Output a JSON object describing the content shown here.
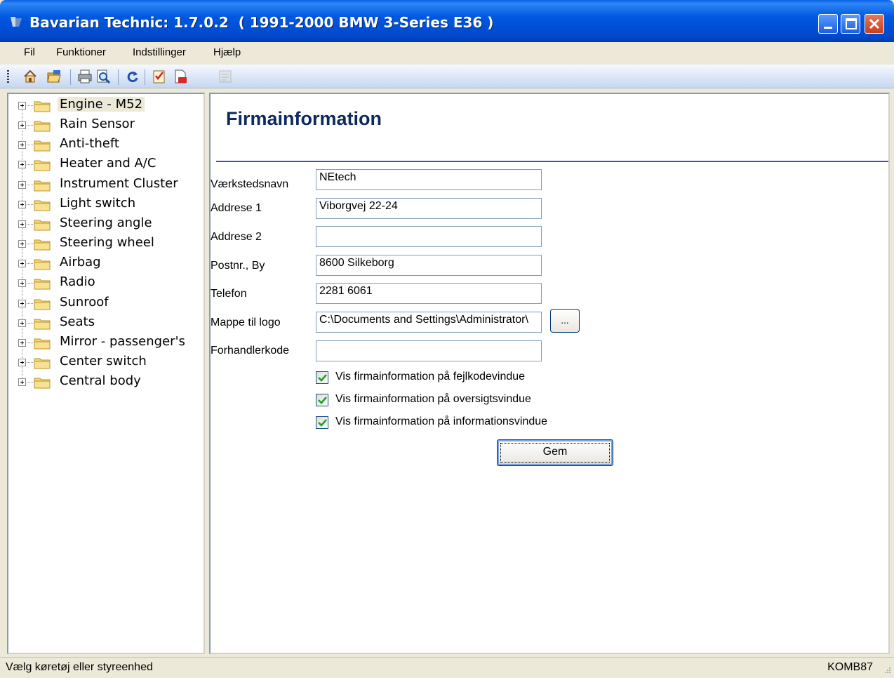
{
  "window": {
    "title": "Bavarian Technic: 1.7.0.2  ( 1991-2000 BMW 3-Series E36 )"
  },
  "menu": {
    "items": [
      {
        "label": "Fil"
      },
      {
        "label": "Funktioner"
      },
      {
        "label": "Indstillinger"
      },
      {
        "label": "Hjælp"
      }
    ]
  },
  "toolbar": {
    "icons": [
      "home-icon",
      "open-folder-icon",
      "print-icon",
      "print-preview-icon",
      "refresh-icon",
      "checklist-icon",
      "pdf-document-icon",
      "report-icon"
    ]
  },
  "tree": {
    "selected_index": 0,
    "items": [
      {
        "label": "Engine - M52"
      },
      {
        "label": "Rain Sensor"
      },
      {
        "label": "Anti-theft"
      },
      {
        "label": "Heater and A/C"
      },
      {
        "label": "Instrument Cluster"
      },
      {
        "label": "Light switch"
      },
      {
        "label": "Steering angle"
      },
      {
        "label": "Steering wheel"
      },
      {
        "label": "Airbag"
      },
      {
        "label": "Radio"
      },
      {
        "label": "Sunroof"
      },
      {
        "label": "Seats"
      },
      {
        "label": "Mirror - passenger's"
      },
      {
        "label": "Center switch"
      },
      {
        "label": "Central body"
      }
    ]
  },
  "form": {
    "heading": "Firmainformation",
    "fields": [
      {
        "label": "Værkstedsnavn",
        "value": "NEtech"
      },
      {
        "label": "Addrese 1",
        "value": "Viborgvej 22-24"
      },
      {
        "label": "Addrese 2",
        "value": ""
      },
      {
        "label": "Postnr., By",
        "value": "8600 Silkeborg"
      },
      {
        "label": "Telefon",
        "value": "2281 6061"
      },
      {
        "label": "Mappe til logo",
        "value": "C:\\Documents and Settings\\Administrator\\"
      },
      {
        "label": "Forhandlerkode",
        "value": ""
      }
    ],
    "browse_label": "...",
    "checkboxes": [
      {
        "label": "Vis firmainformation på fejlkodevindue",
        "checked": true
      },
      {
        "label": "Vis firmainformation på oversigtsvindue",
        "checked": true
      },
      {
        "label": "Vis firmainformation på informationsvindue",
        "checked": true
      }
    ],
    "save_label": "Gem"
  },
  "status": {
    "left": "Vælg køretøj eller styreenhed",
    "right": "KOMB87"
  },
  "colors": {
    "title_bar": "#0058E0",
    "heading": "#0D2A5E",
    "rule": "#3550C0",
    "checkmark": "#21A121"
  }
}
